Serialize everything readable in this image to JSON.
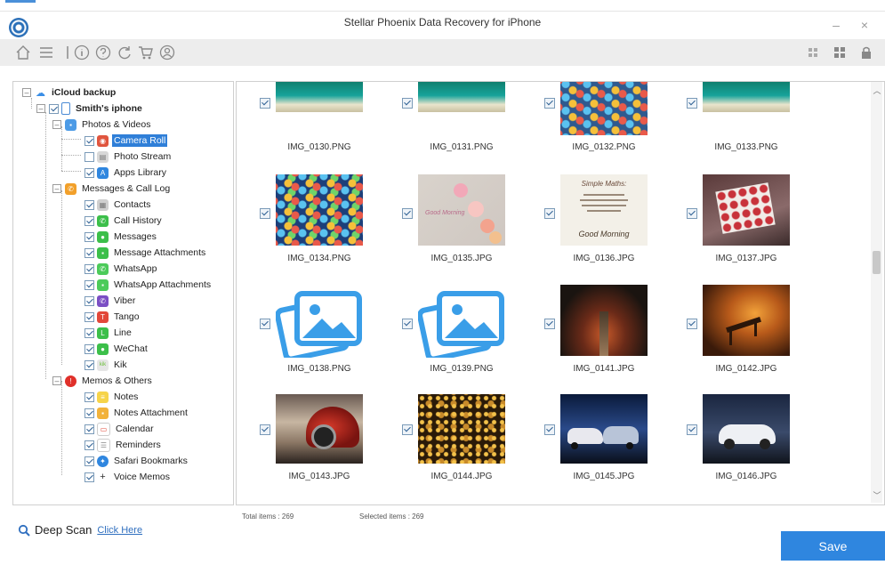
{
  "window": {
    "title": "Stellar Phoenix Data Recovery for iPhone",
    "minimize": "–",
    "close": "×"
  },
  "toolbar": {
    "left_icons": [
      "home-icon",
      "menu-icon",
      "info-icon",
      "help-icon",
      "refresh-icon",
      "cart-icon",
      "user-icon"
    ],
    "right_icons": [
      "large-grid-icon",
      "list-view-icon",
      "lock-icon"
    ]
  },
  "tree": {
    "root": "iCloud backup",
    "device": "Smith's iphone",
    "groups": [
      {
        "label": "Photos & Videos",
        "items": [
          "Camera Roll",
          "Photo Stream",
          "Apps Library"
        ]
      },
      {
        "label": "Messages & Call Log",
        "items": [
          "Contacts",
          "Call History",
          "Messages",
          "Message Attachments",
          "WhatsApp",
          "WhatsApp Attachments",
          "Viber",
          "Tango",
          "Line",
          "WeChat",
          "Kik"
        ]
      },
      {
        "label": "Memos & Others",
        "items": [
          "Notes",
          "Notes Attachment",
          "Calendar",
          "Reminders",
          "Safari Bookmarks",
          "Voice Memos"
        ]
      }
    ],
    "selected": "Camera Roll"
  },
  "gallery": {
    "items": [
      {
        "name": "IMG_0130.PNG",
        "thumb": "sea"
      },
      {
        "name": "IMG_0131.PNG",
        "thumb": "sea"
      },
      {
        "name": "IMG_0132.PNG",
        "thumb": "homescreen"
      },
      {
        "name": "IMG_0133.PNG",
        "thumb": "sea"
      },
      {
        "name": "IMG_0134.PNG",
        "thumb": "homescreen"
      },
      {
        "name": "IMG_0135.JPG",
        "thumb": "flowers"
      },
      {
        "name": "IMG_0136.JPG",
        "thumb": "quote"
      },
      {
        "name": "IMG_0137.JPG",
        "thumb": "hearts"
      },
      {
        "name": "IMG_0138.PNG",
        "thumb": "placeholder"
      },
      {
        "name": "IMG_0139.PNG",
        "thumb": "placeholder"
      },
      {
        "name": "IMG_0141.JPG",
        "thumb": "autumn-road"
      },
      {
        "name": "IMG_0142.JPG",
        "thumb": "bench"
      },
      {
        "name": "IMG_0143.JPG",
        "thumb": "red-car"
      },
      {
        "name": "IMG_0144.JPG",
        "thumb": "bokeh"
      },
      {
        "name": "IMG_0145.JPG",
        "thumb": "cars-night"
      },
      {
        "name": "IMG_0146.JPG",
        "thumb": "white-car"
      }
    ],
    "quote_text": {
      "line1": "Simple Maths:",
      "line2": "Good Morning"
    },
    "flowers_text": "Good Morning"
  },
  "status": {
    "total": "Total items : 269",
    "selected": "Selected items : 269"
  },
  "footer": {
    "deep_scan": "Deep Scan",
    "click_here": "Click Here",
    "save": "Save"
  },
  "colors": {
    "accent": "#2f86df",
    "selection": "#2f7fd8",
    "toolbar_bg": "#ededed"
  }
}
